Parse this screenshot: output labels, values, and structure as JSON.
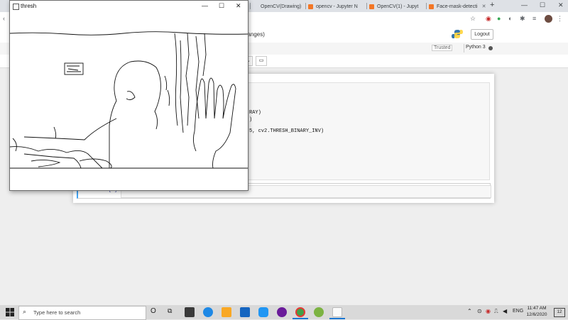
{
  "browser": {
    "tabs": [
      {
        "label": "OpenCV(Drawing)"
      },
      {
        "label": "opencv - Jupyter N"
      },
      {
        "label": "OpenCV(1) - Jupyt"
      },
      {
        "label": "Face-mask-detecti"
      }
    ],
    "new_tab": "+"
  },
  "jupyter": {
    "title_suffix": "hanges)",
    "logout_label": "Logout",
    "trusted_label": "Trusted",
    "kernel_label": "Python 3",
    "code_lines": [
      "RAY)",
      ")",
      "5, cv2.THRESH_BINARY_INV)"
    ],
    "prompt_label": "In [ ]:"
  },
  "thresh_window": {
    "title": "thresh",
    "minimize": "—",
    "maximize": "☐",
    "close": "✕"
  },
  "taskbar": {
    "search_placeholder": "Type here to search",
    "language": "ENG",
    "time": "11:47 AM",
    "date": "12/6/2020",
    "notification_count": "12"
  }
}
